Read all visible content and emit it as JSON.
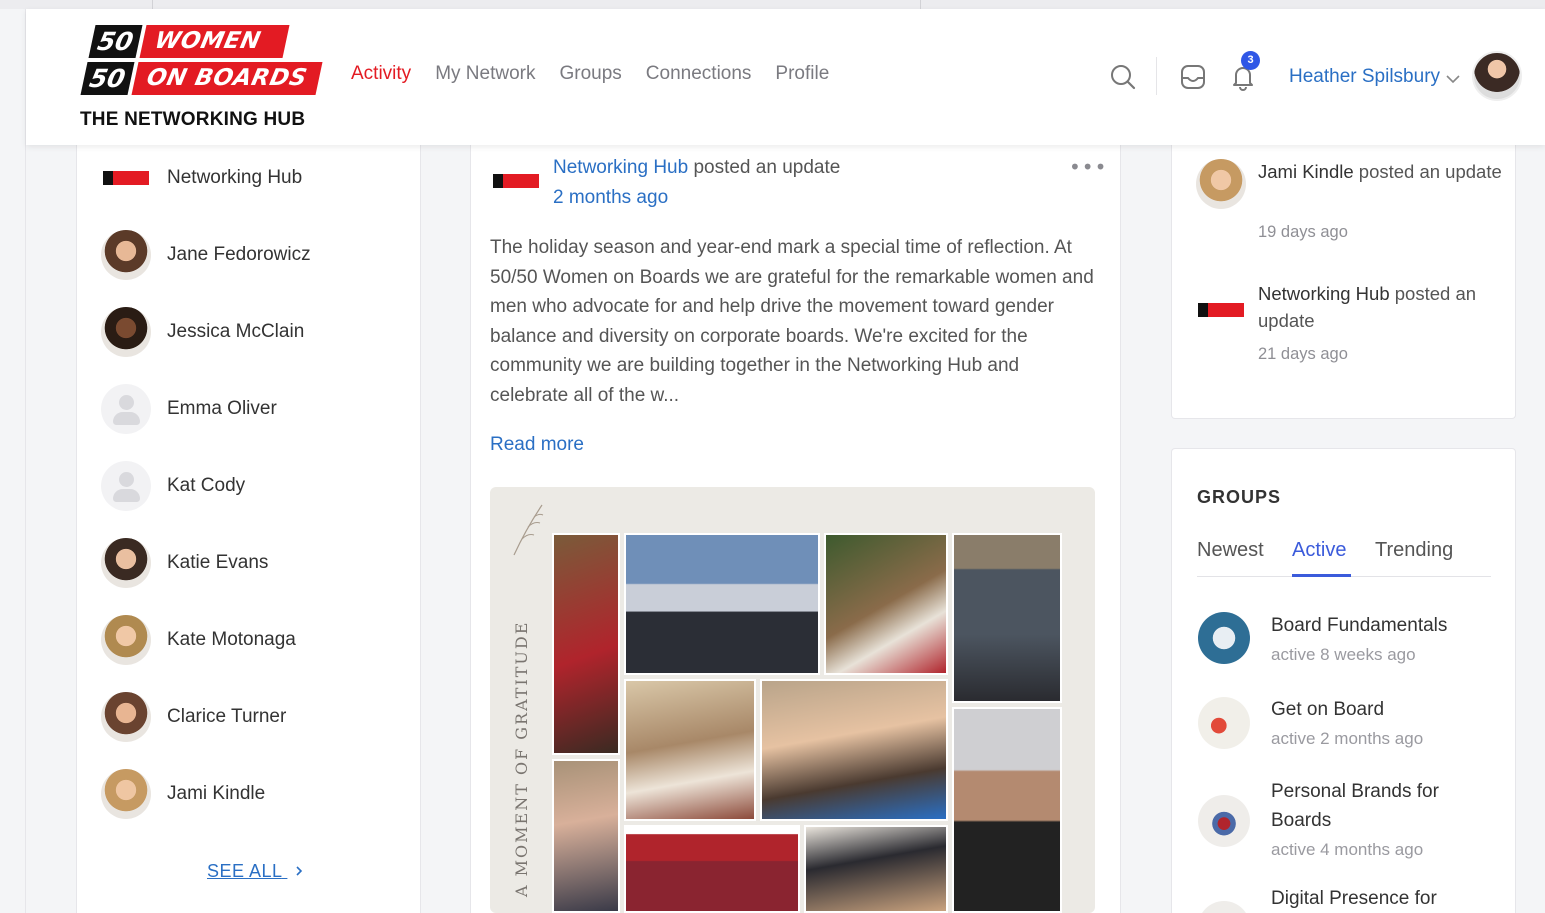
{
  "brand": {
    "logo_num": "50",
    "logo_line1": "WOMEN",
    "logo_line2": "ON BOARDS",
    "logo_sub": "THE NETWORKING HUB",
    "accent": "#e31b23",
    "link": "#2a6fc4"
  },
  "nav": {
    "items": [
      {
        "label": "Activity",
        "active": true
      },
      {
        "label": "My Network"
      },
      {
        "label": "Groups"
      },
      {
        "label": "Connections"
      },
      {
        "label": "Profile"
      }
    ]
  },
  "header": {
    "icons": [
      "search-icon",
      "inbox-icon",
      "bell-icon"
    ],
    "notification_count": "3",
    "user_name": "Heather Spilsbury"
  },
  "members": {
    "items": [
      {
        "name": "Networking Hub",
        "avatar": "logo"
      },
      {
        "name": "Jane Fedorowicz",
        "avatar": "photo"
      },
      {
        "name": "Jessica McClain",
        "avatar": "photo"
      },
      {
        "name": "Emma Oliver",
        "avatar": "placeholder"
      },
      {
        "name": "Kat Cody",
        "avatar": "placeholder"
      },
      {
        "name": "Katie Evans",
        "avatar": "photo"
      },
      {
        "name": "Kate Motonaga",
        "avatar": "photo"
      },
      {
        "name": "Clarice Turner",
        "avatar": "photo"
      },
      {
        "name": "Jami Kindle",
        "avatar": "photo"
      }
    ],
    "see_all": "SEE ALL"
  },
  "post": {
    "author": "Networking Hub",
    "action": " posted an update",
    "time": "2 months ago",
    "more": "•••",
    "body": "The holiday season and year-end mark a special time of reflection. At 50/50 Women on Boards we are grateful for the remarkable women and men who advocate for and help drive the movement toward gender balance and diversity on corporate boards. We're excited for the community we are building together in the Networking Hub and celebrate all of the w...",
    "read_more": "Read more",
    "image_caption": "A MOMENT OF GRATITUDE"
  },
  "activity": {
    "items": [
      {
        "who": "Jami Kindle",
        "action": " posted an update",
        "ago": "19 days ago"
      },
      {
        "who": "Networking Hub",
        "action": " posted an update",
        "ago": "21 days ago"
      }
    ]
  },
  "groups": {
    "title": "GROUPS",
    "tabs": [
      {
        "label": "Newest"
      },
      {
        "label": "Active",
        "active": true
      },
      {
        "label": "Trending"
      }
    ],
    "items": [
      {
        "name": "Board Fundamentals",
        "ago": "active 8 weeks ago"
      },
      {
        "name": "Get on Board",
        "ago": "active 2 months ago"
      },
      {
        "name": "Personal Brands for Boards",
        "ago": "active 4 months ago"
      },
      {
        "name": "Digital Presence for",
        "ago": ""
      }
    ]
  }
}
